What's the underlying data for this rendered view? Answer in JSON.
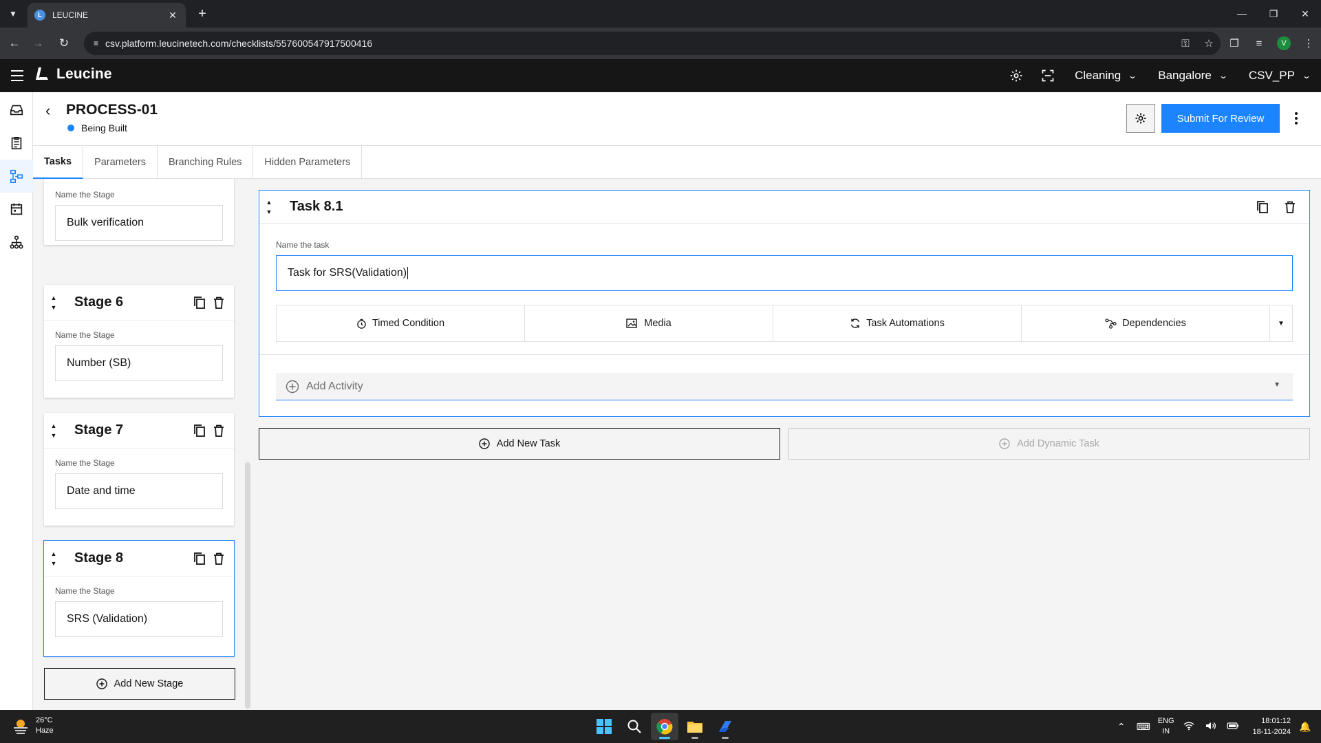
{
  "browser": {
    "tab_title": "LEUCINE",
    "url": "csv.platform.leucinetech.com/checklists/557600547917500416",
    "profile_initial": "V"
  },
  "header": {
    "brand": "Leucine",
    "use_case": "Cleaning",
    "facility": "Bangalore",
    "user": "CSV_PP"
  },
  "page": {
    "title": "PROCESS-01",
    "status": "Being Built",
    "submit_label": "Submit For Review"
  },
  "tabs": [
    {
      "label": "Tasks"
    },
    {
      "label": "Parameters"
    },
    {
      "label": "Branching Rules"
    },
    {
      "label": "Hidden Parameters"
    }
  ],
  "stages": {
    "name_label": "Name the Stage",
    "partial_value": "Bulk verification",
    "items": [
      {
        "title": "Stage 6",
        "value": "Number (SB)"
      },
      {
        "title": "Stage 7",
        "value": "Date and time"
      },
      {
        "title": "Stage 8",
        "value": "SRS (Validation)"
      }
    ],
    "add_label": "Add New Stage"
  },
  "task": {
    "title": "Task 8.1",
    "name_label": "Name the task",
    "name_value": "Task for SRS(Validation)",
    "options": [
      {
        "label": "Timed Condition",
        "icon": "timer-icon"
      },
      {
        "label": "Media",
        "icon": "media-icon"
      },
      {
        "label": "Task Automations",
        "icon": "automation-icon"
      },
      {
        "label": "Dependencies",
        "icon": "dependencies-icon"
      }
    ],
    "add_activity_placeholder": "Add Activity",
    "add_task_label": "Add New Task",
    "add_dynamic_task_label": "Add Dynamic Task"
  },
  "taskbar": {
    "temperature": "26°C",
    "weather": "Haze",
    "lang_top": "ENG",
    "lang_bottom": "IN",
    "time": "18:01:12",
    "date": "18-11-2024"
  },
  "colors": {
    "accent": "#1d84ff",
    "header_bg": "#161616",
    "chrome_bg": "#202124"
  }
}
